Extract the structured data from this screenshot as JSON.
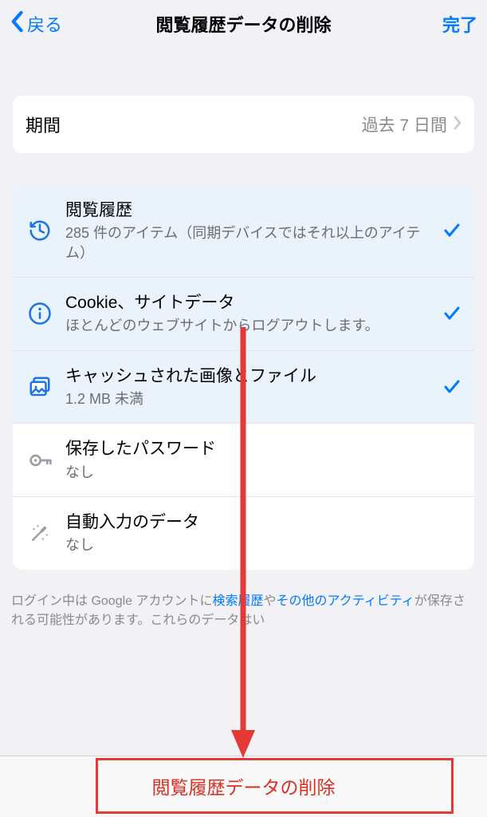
{
  "header": {
    "back": "戻る",
    "title": "閲覧履歴データの削除",
    "done": "完了"
  },
  "period": {
    "label": "期間",
    "value": "過去 7 日間"
  },
  "items": {
    "history": {
      "title": "閲覧履歴",
      "sub": "285 件のアイテム（同期デバイスではそれ以上のアイテム）"
    },
    "cookies": {
      "title": "Cookie、サイトデータ",
      "sub": "ほとんどのウェブサイトからログアウトします。"
    },
    "cache": {
      "title": "キャッシュされた画像とファイル",
      "sub": "1.2 MB 未満"
    },
    "passwords": {
      "title": "保存したパスワード",
      "sub": "なし"
    },
    "autofill": {
      "title": "自動入力のデータ",
      "sub": "なし"
    }
  },
  "footer": {
    "t1": "ログイン中は Google アカウントに",
    "link1": "検索履歴",
    "t2": "や",
    "link2": "その他のアクティビティ",
    "t3": "が保存される可能性があります。これらのデータはい"
  },
  "delete_label": "閲覧履歴データの削除"
}
